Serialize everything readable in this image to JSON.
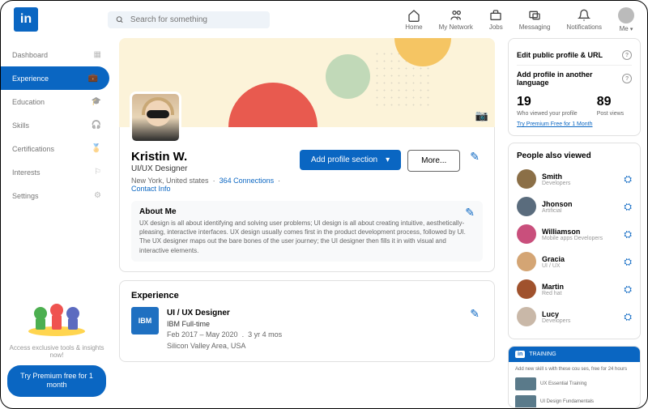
{
  "header": {
    "logo": "in",
    "search_placeholder": "Search for something",
    "nav": [
      {
        "label": "Home"
      },
      {
        "label": "My Network"
      },
      {
        "label": "Jobs"
      },
      {
        "label": "Messaging"
      },
      {
        "label": "Notifications"
      },
      {
        "label": "Me"
      }
    ]
  },
  "sidebar": {
    "items": [
      {
        "label": "Dashboard"
      },
      {
        "label": "Experience"
      },
      {
        "label": "Education"
      },
      {
        "label": "Skills"
      },
      {
        "label": "Certifications"
      },
      {
        "label": "Interests"
      },
      {
        "label": "Settings"
      }
    ],
    "promo_text": "Access exclusive tools & insights now!",
    "promo_btn": "Try Premium free for 1 month"
  },
  "profile": {
    "name": "Kristin W.",
    "title": "UI/UX Designer",
    "location": "New York, United states",
    "connections": "364 Connections",
    "contact": "Contact Info",
    "add_section": "Add profile section",
    "more": "More...",
    "about_heading": "About Me",
    "about_text": "UX design is all about identifying and solving user problems; UI design is all about creating intuitive, aesthetically-pleasing, interactive interfaces. UX design usually comes first in the product development process, followed by UI. The UX designer maps out the bare bones of the user journey; the UI designer then fills it in with visual and interactive elements."
  },
  "experience": {
    "heading": "Experience",
    "job": {
      "title": "UI / UX Designer",
      "company": "IBM Full-time",
      "dates": "Feb 2017 – May 2020",
      "duration": "3 yr 4 mos",
      "location": "Silicon Valley Area, USA",
      "logo": "IBM"
    }
  },
  "right": {
    "edit_url": "Edit public profile & URL",
    "add_lang": "Add profile in another language",
    "views_num": "19",
    "views_lbl": "Who viewed your profile",
    "posts_num": "89",
    "posts_lbl": "Post views",
    "promo": "Try Premium Free for 1 Month",
    "people_heading": "People also viewed",
    "people": [
      {
        "name": "Smith",
        "role": "Developers",
        "color": "#8b6f47"
      },
      {
        "name": "Jhonson",
        "role": "Artificial",
        "color": "#5a6c7d"
      },
      {
        "name": "Williamson",
        "role": "Mobile apps Developers",
        "color": "#c94f7c"
      },
      {
        "name": "Gracia",
        "role": "UI / UX",
        "color": "#d4a574"
      },
      {
        "name": "Martin",
        "role": "Red hat",
        "color": "#a0522d"
      },
      {
        "name": "Lucy",
        "role": "Developers",
        "color": "#c9b8a8"
      }
    ],
    "training_brand": "in",
    "training_label": "TRAINING",
    "training_desc": "Add new skill s with these cou ses, free for 24 hours",
    "courses": [
      "UX Essential Training",
      "UI Design Fundamentals"
    ]
  }
}
